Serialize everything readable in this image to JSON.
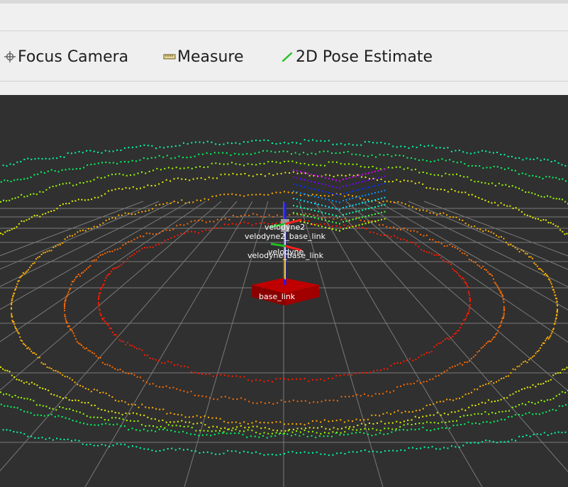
{
  "toolbar": {
    "tools": [
      {
        "label": "Focus Camera",
        "icon": "focus-camera-icon"
      },
      {
        "label": "Measure",
        "icon": "ruler-icon"
      },
      {
        "label": "2D Pose Estimate",
        "icon": "pose-arrow-icon",
        "icon_color": "#22c322"
      }
    ]
  },
  "viewport": {
    "background": "#303030",
    "grid_color": "#7a7a7a",
    "frames": [
      {
        "label": "velodyne2"
      },
      {
        "label": "velodyne2_base_link"
      },
      {
        "label": "velodyne"
      },
      {
        "label": "velodyne_base_link"
      },
      {
        "label": "base_link"
      }
    ],
    "ring_colors": [
      "#ff1a00",
      "#ff6a00",
      "#ffb000",
      "#e8f000",
      "#9cff00",
      "#00ff60",
      "#00ffb0"
    ],
    "cube_colors": [
      "#d000ff",
      "#7000ff",
      "#0030ff",
      "#0090ff",
      "#00e0ff",
      "#00ffb0",
      "#40ff40",
      "#b0ff00"
    ]
  }
}
